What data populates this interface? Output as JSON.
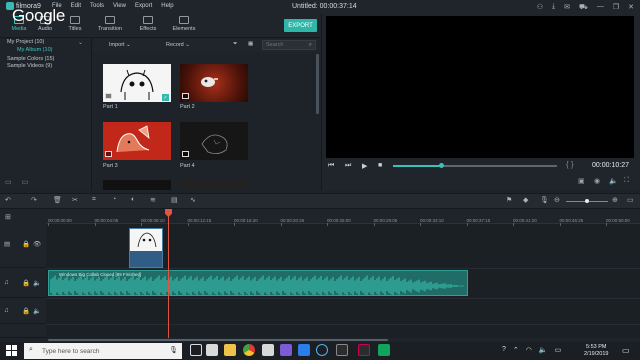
{
  "app": {
    "logo_text": "filmora9",
    "menus": [
      "File",
      "Edit",
      "Tools",
      "View",
      "Export",
      "Help"
    ],
    "doc_title": "Untitled:",
    "doc_time": "00:00:37:14",
    "title_icons": [
      "account-icon",
      "download-icon",
      "mail-icon",
      "cart-icon",
      "minimize-icon",
      "restore-icon",
      "close-icon"
    ]
  },
  "overlay": {
    "google_text": "Google"
  },
  "tabs": [
    {
      "label": "Media",
      "active": true
    },
    {
      "label": "Audio",
      "active": false
    },
    {
      "label": "Titles",
      "active": false
    },
    {
      "label": "Transition",
      "active": false
    },
    {
      "label": "Effects",
      "active": false
    },
    {
      "label": "Elements",
      "active": false
    }
  ],
  "export_label": "EXPORT",
  "library": {
    "items": [
      {
        "label": "My Project (10)",
        "selected": false
      },
      {
        "label": "My Album (10)",
        "selected": true
      },
      {
        "label": "Sample Colors (15)",
        "selected": false
      },
      {
        "label": "Sample Videos (9)",
        "selected": false
      }
    ]
  },
  "media_toolbar": {
    "import_label": "Import",
    "record_label": "Record",
    "search_placeholder": "Search"
  },
  "media_items": [
    {
      "label": "Part 1",
      "selected": true
    },
    {
      "label": "Part 2",
      "selected": false
    },
    {
      "label": "Part 3",
      "selected": false
    },
    {
      "label": "Part 4",
      "selected": false
    }
  ],
  "preview": {
    "timecode": "00:00:10:27",
    "progress": 0.29
  },
  "timeline": {
    "ticks": [
      "00:00:00:00",
      "00:00:04:05",
      "00:00:08:10",
      "00:00:12:15",
      "00:00:16:20",
      "00:00:20:25",
      "00:00:25:00",
      "00:00:29:05",
      "00:00:33:10",
      "00:00:37:15",
      "00:00:41:20",
      "00:00:45:25",
      "00:00:50:00"
    ],
    "audio_clip_title": "Windows Big Collab Closed [89 Finished]",
    "zoom": 0.5
  },
  "taskbar": {
    "search_placeholder": "Type here to search",
    "time": "5:53 PM",
    "date": "2/19/2019"
  },
  "colors": {
    "accent": "#3ec7c0",
    "export": "#2eb6a8",
    "playhead": "#e0553f",
    "audio_clip": "#1f6d66",
    "video_clip": "#2f5d86"
  }
}
